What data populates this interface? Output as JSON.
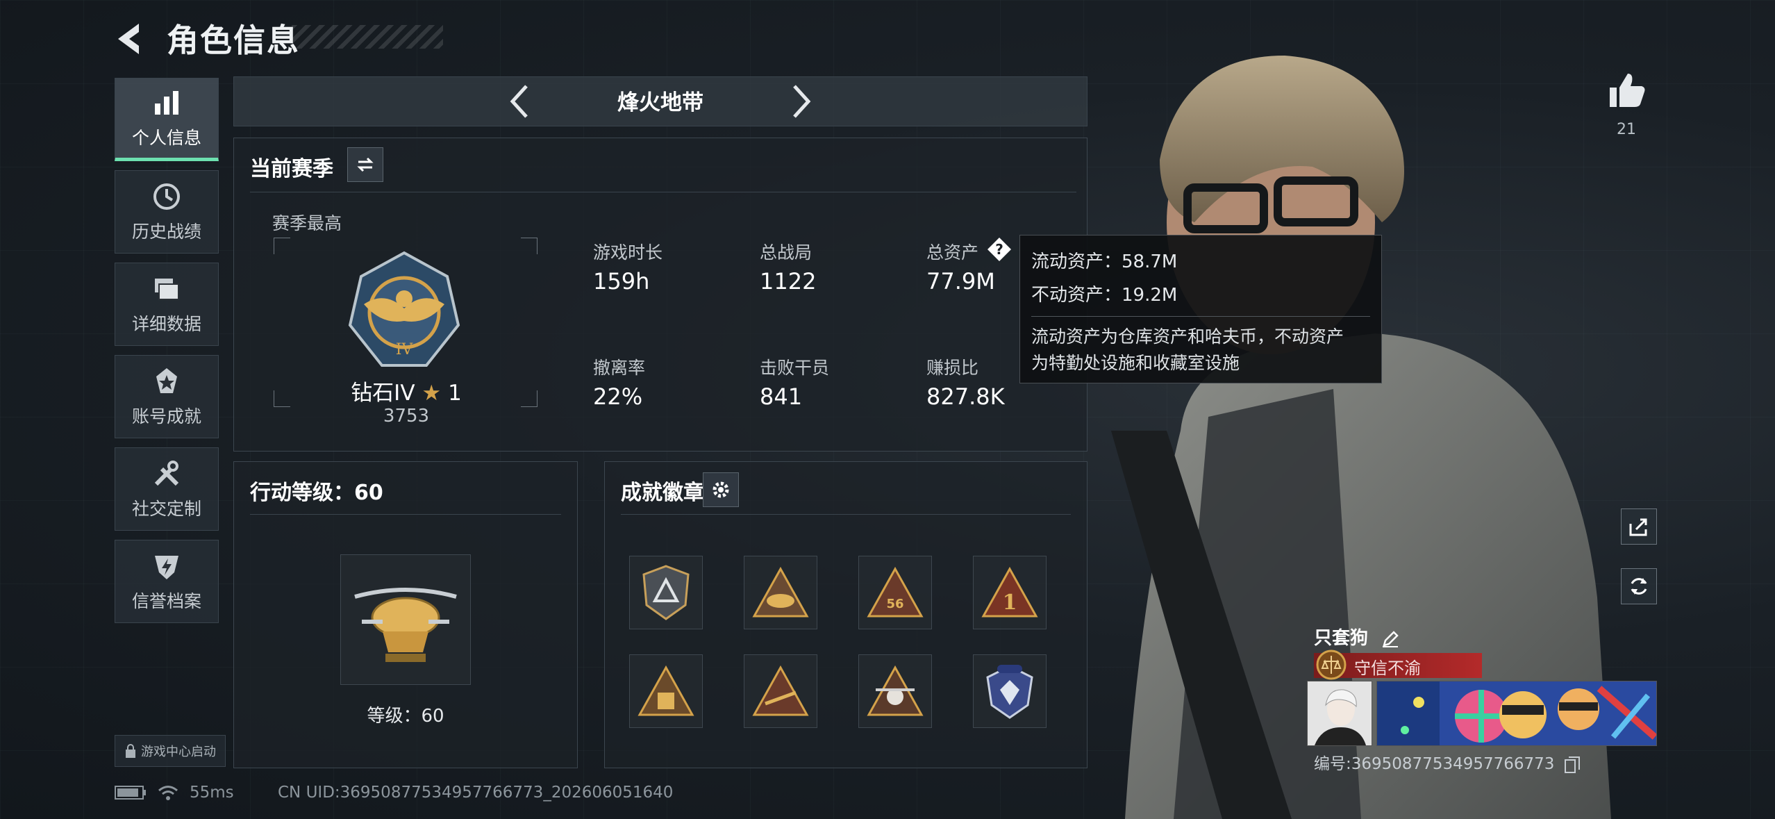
{
  "header": {
    "title": "角色信息"
  },
  "sidebar": {
    "items": [
      {
        "label": "个人信息",
        "icon": "bar-chart-icon",
        "active": true
      },
      {
        "label": "历史战绩",
        "icon": "clock-icon",
        "active": false
      },
      {
        "label": "详细数据",
        "icon": "folder-stack-icon",
        "active": false
      },
      {
        "label": "账号成就",
        "icon": "achievement-icon",
        "active": false
      },
      {
        "label": "社交定制",
        "icon": "tools-icon",
        "active": false
      },
      {
        "label": "信誉档案",
        "icon": "shield-bolt-icon",
        "active": false
      }
    ],
    "game_center": "游戏中心启动"
  },
  "mode": {
    "title": "烽火地带"
  },
  "season": {
    "title": "当前赛季",
    "best_label": "赛季最高",
    "rank_name": "钻石IV",
    "rank_stars": "1",
    "rank_points": "3753",
    "stats": [
      {
        "label": "游戏时长",
        "value": "159h"
      },
      {
        "label": "总战局",
        "value": "1122"
      },
      {
        "label": "总资产",
        "value": "77.9M"
      },
      {
        "label": "撤离率",
        "value": "22%"
      },
      {
        "label": "击败干员",
        "value": "841"
      },
      {
        "label": "赚损比",
        "value": "827.8K"
      }
    ]
  },
  "tooltip": {
    "liquid": "流动资产：58.7M",
    "fixed": "不动资产：19.2M",
    "desc_line1": "流动资产为仓库资产和哈夫币，不动资产",
    "desc_line2": "为特勤处设施和收藏室设施"
  },
  "level": {
    "title": "行动等级：60",
    "caption": "等级：60"
  },
  "badges": {
    "title": "成就徽章",
    "items": [
      "badge-triangle-grey",
      "badge-helmet",
      "badge-56",
      "badge-number-1",
      "badge-crate",
      "badge-rifle",
      "badge-skull",
      "badge-police"
    ]
  },
  "player": {
    "likes": "21",
    "name": "只套狗",
    "motto": "守信不渝",
    "card_id": "编号:36950877534957766773"
  },
  "status": {
    "ping": "55ms",
    "uid": "CN UID:36950877534957766773_202606051640"
  },
  "colors": {
    "accent": "#6de0b0",
    "motto_bg": "#b42a2a",
    "gold": "#d4a24a"
  }
}
